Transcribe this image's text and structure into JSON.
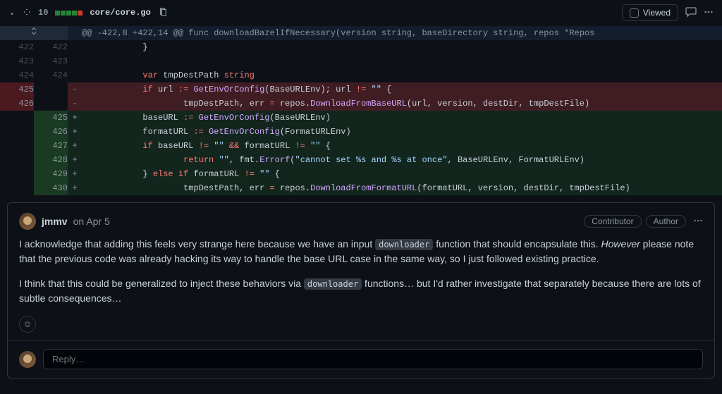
{
  "file_header": {
    "diff_count": "10",
    "additions": 6,
    "deletions": 2,
    "path": "core/core.go",
    "viewed_label": "Viewed"
  },
  "hunk_header": "@@ -422,8 +422,14 @@ func downloadBazelIfNecessary(version string, baseDirectory string, repos *Repos",
  "lines": [
    {
      "type": "ctx",
      "old": "422",
      "new": "422",
      "tokens": [
        [
          "plain",
          "            }"
        ]
      ]
    },
    {
      "type": "ctx",
      "old": "423",
      "new": "423",
      "tokens": [
        [
          "plain",
          ""
        ]
      ]
    },
    {
      "type": "ctx",
      "old": "424",
      "new": "424",
      "tokens": [
        [
          "plain",
          "            "
        ],
        [
          "kw",
          "var"
        ],
        [
          "plain",
          " tmpDestPath "
        ],
        [
          "kw",
          "string"
        ]
      ]
    },
    {
      "type": "del",
      "old": "425",
      "new": "",
      "tokens": [
        [
          "plain",
          "            "
        ],
        [
          "kw",
          "if"
        ],
        [
          "plain",
          " url "
        ],
        [
          "op",
          ":="
        ],
        [
          "plain",
          " "
        ],
        [
          "fn",
          "GetEnvOrConfig"
        ],
        [
          "plain",
          "(BaseURLEnv); url "
        ],
        [
          "op",
          "!="
        ],
        [
          "plain",
          " "
        ],
        [
          "str",
          "\"\""
        ],
        [
          "plain",
          " {"
        ]
      ]
    },
    {
      "type": "del",
      "old": "426",
      "new": "",
      "tokens": [
        [
          "plain",
          "                    tmpDestPath, err "
        ],
        [
          "op",
          "="
        ],
        [
          "plain",
          " repos."
        ],
        [
          "fn",
          "DownloadFromBaseURL"
        ],
        [
          "plain",
          "(url, version, destDir, tmpDestFile)"
        ]
      ]
    },
    {
      "type": "add",
      "old": "",
      "new": "425",
      "tokens": [
        [
          "plain",
          "            baseURL "
        ],
        [
          "op",
          ":="
        ],
        [
          "plain",
          " "
        ],
        [
          "fn",
          "GetEnvOrConfig"
        ],
        [
          "plain",
          "(BaseURLEnv)"
        ]
      ]
    },
    {
      "type": "add",
      "old": "",
      "new": "426",
      "tokens": [
        [
          "plain",
          "            formatURL "
        ],
        [
          "op",
          ":="
        ],
        [
          "plain",
          " "
        ],
        [
          "fn",
          "GetEnvOrConfig"
        ],
        [
          "plain",
          "(FormatURLEnv)"
        ]
      ]
    },
    {
      "type": "add",
      "old": "",
      "new": "427",
      "tokens": [
        [
          "plain",
          "            "
        ],
        [
          "kw",
          "if"
        ],
        [
          "plain",
          " baseURL "
        ],
        [
          "op",
          "!="
        ],
        [
          "plain",
          " "
        ],
        [
          "str",
          "\"\""
        ],
        [
          "plain",
          " "
        ],
        [
          "op",
          "&&"
        ],
        [
          "plain",
          " formatURL "
        ],
        [
          "op",
          "!="
        ],
        [
          "plain",
          " "
        ],
        [
          "str",
          "\"\""
        ],
        [
          "plain",
          " {"
        ]
      ]
    },
    {
      "type": "add",
      "old": "",
      "new": "428",
      "tokens": [
        [
          "plain",
          "                    "
        ],
        [
          "kw",
          "return"
        ],
        [
          "plain",
          " "
        ],
        [
          "str",
          "\"\""
        ],
        [
          "plain",
          ", fmt."
        ],
        [
          "fn",
          "Errorf"
        ],
        [
          "plain",
          "("
        ],
        [
          "str",
          "\"cannot set %s and %s at once\""
        ],
        [
          "plain",
          ", BaseURLEnv, FormatURLEnv)"
        ]
      ]
    },
    {
      "type": "add",
      "old": "",
      "new": "429",
      "tokens": [
        [
          "plain",
          "            } "
        ],
        [
          "kw",
          "else if"
        ],
        [
          "plain",
          " formatURL "
        ],
        [
          "op",
          "!="
        ],
        [
          "plain",
          " "
        ],
        [
          "str",
          "\"\""
        ],
        [
          "plain",
          " {"
        ]
      ]
    },
    {
      "type": "add",
      "old": "",
      "new": "430",
      "tokens": [
        [
          "plain",
          "                    tmpDestPath, err "
        ],
        [
          "op",
          "="
        ],
        [
          "plain",
          " repos."
        ],
        [
          "fn",
          "DownloadFromFormatURL"
        ],
        [
          "plain",
          "(formatURL, version, destDir, tmpDestFile)"
        ]
      ]
    }
  ],
  "comment": {
    "author": "jmmv",
    "date": "on Apr 5",
    "badges": [
      "Contributor",
      "Author"
    ],
    "body_p1_pre": "I acknowledge that adding this feels very strange here because we have an input ",
    "body_p1_code": "downloader",
    "body_p1_mid": " function that should encapsulate this. ",
    "body_p1_em": "However",
    "body_p1_post": " please note that the previous code was already hacking its way to handle the base URL case in the same way, so I just followed existing practice.",
    "body_p2_pre": "I think that this could be generalized to inject these behaviors via ",
    "body_p2_code": "downloader",
    "body_p2_post": " functions… but I'd rather investigate that separately because there are lots of subtle consequences…",
    "reply_placeholder": "Reply…"
  }
}
